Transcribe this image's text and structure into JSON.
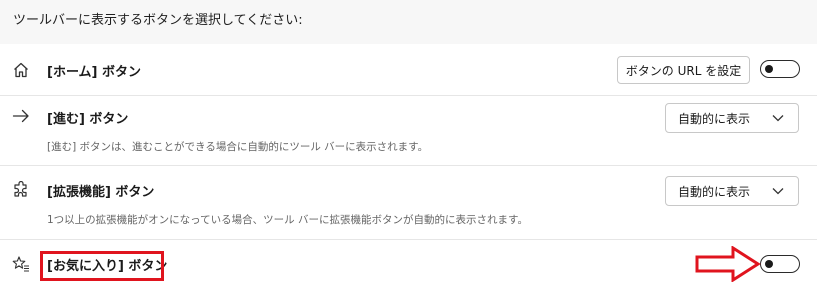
{
  "heading": "ツールバーに表示するボタンを選択してください:",
  "rows": [
    {
      "icon": "home-icon",
      "title": "[ホーム] ボタン",
      "button_label": "ボタンの URL を設定",
      "toggle_on": false
    },
    {
      "icon": "arrow-right-icon",
      "title": "[進む] ボタン",
      "description": "[進む] ボタンは、進むことができる場合に自動的にツール バーに表示されます。",
      "select_value": "自動的に表示"
    },
    {
      "icon": "puzzle-icon",
      "title": "[拡張機能] ボタン",
      "description": "1つ以上の拡張機能がオンになっている場合、ツール バーに拡張機能ボタンが自動的に表示されます。",
      "select_value": "自動的に表示"
    },
    {
      "icon": "favorites-icon",
      "title": "[お気に入り] ボタン",
      "toggle_on": false
    }
  ],
  "colors": {
    "annotation": "#e0141e",
    "background": "#f7f7f7",
    "panel": "#ffffff"
  }
}
